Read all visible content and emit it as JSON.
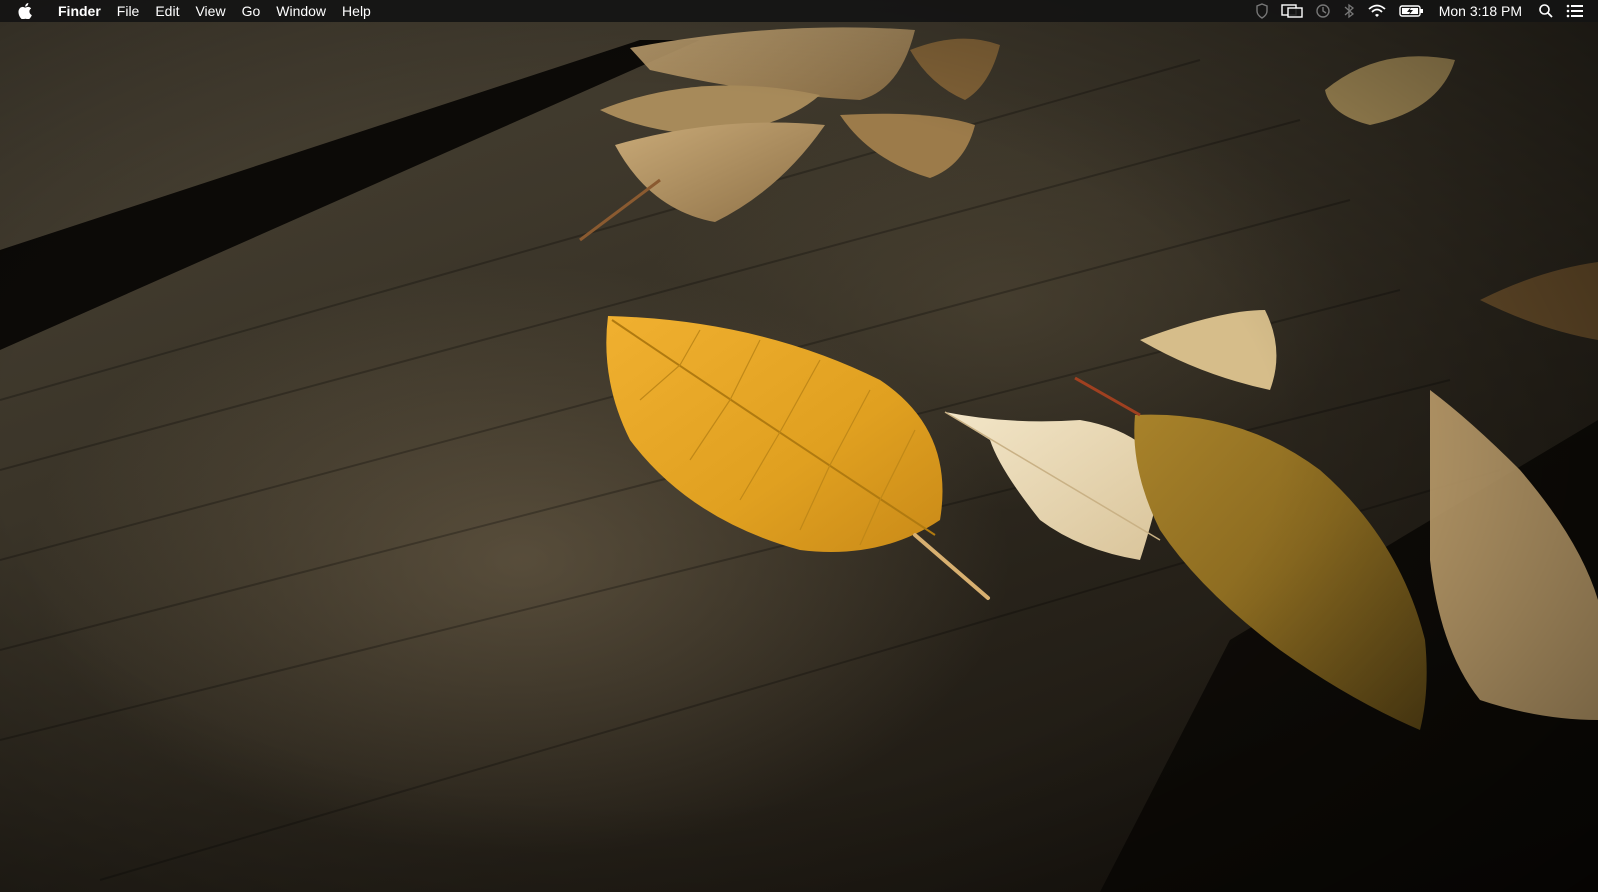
{
  "menubar": {
    "apple_icon": "apple-logo-icon",
    "app_name": "Finder",
    "items": [
      "File",
      "Edit",
      "View",
      "Go",
      "Window",
      "Help"
    ],
    "status_icons": [
      "shield-icon",
      "display-mirroring-icon",
      "time-machine-icon",
      "bluetooth-icon",
      "wifi-icon",
      "battery-charging-icon"
    ],
    "clock": "Mon 3:18 PM",
    "spotlight_icon": "search-icon",
    "notification_icon": "list-icon"
  },
  "desktop": {
    "wallpaper": "autumn-leaves-on-wooden-planks"
  },
  "colors": {
    "menubar_bg": "#141414",
    "menubar_text": "#ffffff",
    "leaf_yellow": "#e0a62a",
    "wood_dark": "#2a251c"
  }
}
